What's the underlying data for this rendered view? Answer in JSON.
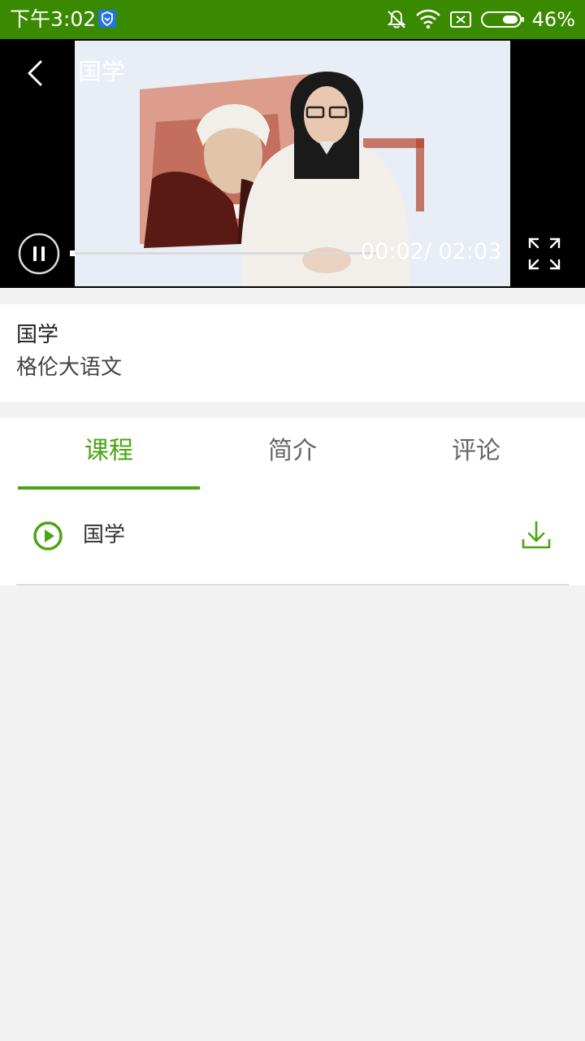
{
  "status_bar": {
    "time": "下午3:02",
    "battery_pct": "46%",
    "icons": [
      "shield-icon",
      "bell-off-icon",
      "wifi-icon",
      "sim-x-icon",
      "battery-icon"
    ],
    "color": "#3a8a00"
  },
  "player": {
    "title": "国学",
    "time_display": "00:02/ 02:03",
    "progress": 0.016,
    "state": "playing"
  },
  "info": {
    "title": "国学",
    "subtitle": "格伦大语文"
  },
  "tabs": [
    {
      "label": "课程",
      "active": true
    },
    {
      "label": "简介",
      "active": false
    },
    {
      "label": "评论",
      "active": false
    }
  ],
  "lessons": [
    {
      "title": "国学"
    }
  ],
  "colors": {
    "accent": "#4ba511",
    "background": "#f2f2f2"
  }
}
